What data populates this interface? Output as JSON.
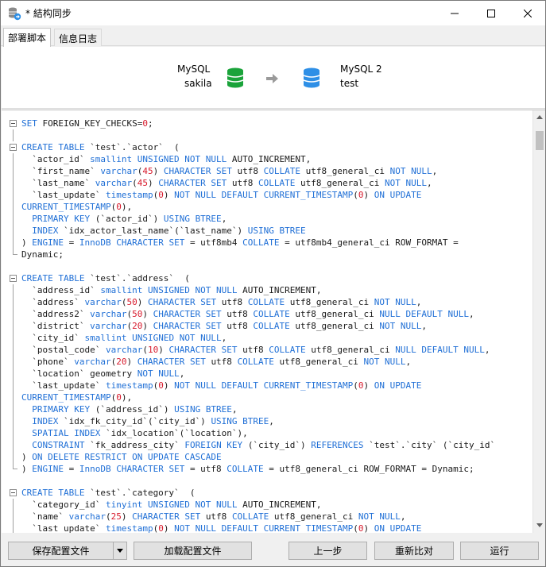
{
  "window": {
    "title": "* 結构同步",
    "icon": "database-sync-icon"
  },
  "tabs": [
    {
      "label": "部署脚本",
      "active": true
    },
    {
      "label": "信息日志",
      "active": false
    }
  ],
  "source": {
    "connection": "MySQL",
    "database": "sakila",
    "color": "#1aa33a"
  },
  "target": {
    "connection": "MySQL 2",
    "database": "test",
    "color": "#2e8fe6"
  },
  "colors": {
    "keyword": "#1f6fd6",
    "number": "#d7192b"
  },
  "code_lines": [
    [
      {
        "t": "SET ",
        "k": 1
      },
      {
        "t": "FOREIGN_KEY_CHECKS="
      },
      {
        "t": "0",
        "n": 1
      },
      {
        "t": ";"
      }
    ],
    [],
    [
      {
        "t": "CREATE TABLE ",
        "k": 1
      },
      {
        "t": "`test`.`actor`  ("
      }
    ],
    [
      {
        "t": "  `actor_id` "
      },
      {
        "t": "smallint UNSIGNED NOT NULL ",
        "k": 1
      },
      {
        "t": "AUTO_INCREMENT,"
      }
    ],
    [
      {
        "t": "  `first_name` "
      },
      {
        "t": "varchar",
        "k": 1
      },
      {
        "t": "("
      },
      {
        "t": "45",
        "n": 1
      },
      {
        "t": ") "
      },
      {
        "t": "CHARACTER SET ",
        "k": 1
      },
      {
        "t": "utf8 "
      },
      {
        "t": "COLLATE ",
        "k": 1
      },
      {
        "t": "utf8_general_ci "
      },
      {
        "t": "NOT NULL",
        "k": 1
      },
      {
        "t": ","
      }
    ],
    [
      {
        "t": "  `last_name` "
      },
      {
        "t": "varchar",
        "k": 1
      },
      {
        "t": "("
      },
      {
        "t": "45",
        "n": 1
      },
      {
        "t": ") "
      },
      {
        "t": "CHARACTER SET ",
        "k": 1
      },
      {
        "t": "utf8 "
      },
      {
        "t": "COLLATE ",
        "k": 1
      },
      {
        "t": "utf8_general_ci "
      },
      {
        "t": "NOT NULL",
        "k": 1
      },
      {
        "t": ","
      }
    ],
    [
      {
        "t": "  `last_update` "
      },
      {
        "t": "timestamp",
        "k": 1
      },
      {
        "t": "("
      },
      {
        "t": "0",
        "n": 1
      },
      {
        "t": ") "
      },
      {
        "t": "NOT NULL DEFAULT CURRENT_TIMESTAMP",
        "k": 1
      },
      {
        "t": "("
      },
      {
        "t": "0",
        "n": 1
      },
      {
        "t": ") "
      },
      {
        "t": "ON UPDATE",
        "k": 1
      }
    ],
    [
      {
        "t": "CURRENT_TIMESTAMP",
        "k": 1
      },
      {
        "t": "("
      },
      {
        "t": "0",
        "n": 1
      },
      {
        "t": "),"
      }
    ],
    [
      {
        "t": "  "
      },
      {
        "t": "PRIMARY KEY ",
        "k": 1
      },
      {
        "t": "(`actor_id`) "
      },
      {
        "t": "USING BTREE",
        "k": 1
      },
      {
        "t": ","
      }
    ],
    [
      {
        "t": "  "
      },
      {
        "t": "INDEX ",
        "k": 1
      },
      {
        "t": "`idx_actor_last_name`(`last_name`) "
      },
      {
        "t": "USING BTREE",
        "k": 1
      }
    ],
    [
      {
        "t": ") "
      },
      {
        "t": "ENGINE ",
        "k": 1
      },
      {
        "t": "= "
      },
      {
        "t": "InnoDB ",
        "k": 1
      },
      {
        "t": "CHARACTER SET ",
        "k": 1
      },
      {
        "t": "= utf8mb4 "
      },
      {
        "t": "COLLATE ",
        "k": 1
      },
      {
        "t": "= utf8mb4_general_ci ROW_FORMAT ="
      }
    ],
    [
      {
        "t": "Dynamic;"
      }
    ],
    [],
    [
      {
        "t": "CREATE TABLE ",
        "k": 1
      },
      {
        "t": "`test`.`address`  ("
      }
    ],
    [
      {
        "t": "  `address_id` "
      },
      {
        "t": "smallint UNSIGNED NOT NULL ",
        "k": 1
      },
      {
        "t": "AUTO_INCREMENT,"
      }
    ],
    [
      {
        "t": "  `address` "
      },
      {
        "t": "varchar",
        "k": 1
      },
      {
        "t": "("
      },
      {
        "t": "50",
        "n": 1
      },
      {
        "t": ") "
      },
      {
        "t": "CHARACTER SET ",
        "k": 1
      },
      {
        "t": "utf8 "
      },
      {
        "t": "COLLATE ",
        "k": 1
      },
      {
        "t": "utf8_general_ci "
      },
      {
        "t": "NOT NULL",
        "k": 1
      },
      {
        "t": ","
      }
    ],
    [
      {
        "t": "  `address2` "
      },
      {
        "t": "varchar",
        "k": 1
      },
      {
        "t": "("
      },
      {
        "t": "50",
        "n": 1
      },
      {
        "t": ") "
      },
      {
        "t": "CHARACTER SET ",
        "k": 1
      },
      {
        "t": "utf8 "
      },
      {
        "t": "COLLATE ",
        "k": 1
      },
      {
        "t": "utf8_general_ci "
      },
      {
        "t": "NULL DEFAULT NULL",
        "k": 1
      },
      {
        "t": ","
      }
    ],
    [
      {
        "t": "  `district` "
      },
      {
        "t": "varchar",
        "k": 1
      },
      {
        "t": "("
      },
      {
        "t": "20",
        "n": 1
      },
      {
        "t": ") "
      },
      {
        "t": "CHARACTER SET ",
        "k": 1
      },
      {
        "t": "utf8 "
      },
      {
        "t": "COLLATE ",
        "k": 1
      },
      {
        "t": "utf8_general_ci "
      },
      {
        "t": "NOT NULL",
        "k": 1
      },
      {
        "t": ","
      }
    ],
    [
      {
        "t": "  `city_id` "
      },
      {
        "t": "smallint UNSIGNED NOT NULL",
        "k": 1
      },
      {
        "t": ","
      }
    ],
    [
      {
        "t": "  `postal_code` "
      },
      {
        "t": "varchar",
        "k": 1
      },
      {
        "t": "("
      },
      {
        "t": "10",
        "n": 1
      },
      {
        "t": ") "
      },
      {
        "t": "CHARACTER SET ",
        "k": 1
      },
      {
        "t": "utf8 "
      },
      {
        "t": "COLLATE ",
        "k": 1
      },
      {
        "t": "utf8_general_ci "
      },
      {
        "t": "NULL DEFAULT NULL",
        "k": 1
      },
      {
        "t": ","
      }
    ],
    [
      {
        "t": "  `phone` "
      },
      {
        "t": "varchar",
        "k": 1
      },
      {
        "t": "("
      },
      {
        "t": "20",
        "n": 1
      },
      {
        "t": ") "
      },
      {
        "t": "CHARACTER SET ",
        "k": 1
      },
      {
        "t": "utf8 "
      },
      {
        "t": "COLLATE ",
        "k": 1
      },
      {
        "t": "utf8_general_ci "
      },
      {
        "t": "NOT NULL",
        "k": 1
      },
      {
        "t": ","
      }
    ],
    [
      {
        "t": "  `location` geometry "
      },
      {
        "t": "NOT NULL",
        "k": 1
      },
      {
        "t": ","
      }
    ],
    [
      {
        "t": "  `last_update` "
      },
      {
        "t": "timestamp",
        "k": 1
      },
      {
        "t": "("
      },
      {
        "t": "0",
        "n": 1
      },
      {
        "t": ") "
      },
      {
        "t": "NOT NULL DEFAULT CURRENT_TIMESTAMP",
        "k": 1
      },
      {
        "t": "("
      },
      {
        "t": "0",
        "n": 1
      },
      {
        "t": ") "
      },
      {
        "t": "ON UPDATE",
        "k": 1
      }
    ],
    [
      {
        "t": "CURRENT_TIMESTAMP",
        "k": 1
      },
      {
        "t": "("
      },
      {
        "t": "0",
        "n": 1
      },
      {
        "t": "),"
      }
    ],
    [
      {
        "t": "  "
      },
      {
        "t": "PRIMARY KEY ",
        "k": 1
      },
      {
        "t": "(`address_id`) "
      },
      {
        "t": "USING BTREE",
        "k": 1
      },
      {
        "t": ","
      }
    ],
    [
      {
        "t": "  "
      },
      {
        "t": "INDEX ",
        "k": 1
      },
      {
        "t": "`idx_fk_city_id`(`city_id`) "
      },
      {
        "t": "USING BTREE",
        "k": 1
      },
      {
        "t": ","
      }
    ],
    [
      {
        "t": "  "
      },
      {
        "t": "SPATIAL INDEX ",
        "k": 1
      },
      {
        "t": "`idx_location`(`location`),"
      }
    ],
    [
      {
        "t": "  "
      },
      {
        "t": "CONSTRAINT ",
        "k": 1
      },
      {
        "t": "`fk_address_city` "
      },
      {
        "t": "FOREIGN KEY ",
        "k": 1
      },
      {
        "t": "(`city_id`) "
      },
      {
        "t": "REFERENCES ",
        "k": 1
      },
      {
        "t": "`test`.`city` (`city_id`"
      }
    ],
    [
      {
        "t": ") "
      },
      {
        "t": "ON DELETE RESTRICT ON UPDATE CASCADE",
        "k": 1
      }
    ],
    [
      {
        "t": ") "
      },
      {
        "t": "ENGINE ",
        "k": 1
      },
      {
        "t": "= "
      },
      {
        "t": "InnoDB ",
        "k": 1
      },
      {
        "t": "CHARACTER SET ",
        "k": 1
      },
      {
        "t": "= utf8 "
      },
      {
        "t": "COLLATE ",
        "k": 1
      },
      {
        "t": "= utf8_general_ci ROW_FORMAT = Dynamic;"
      }
    ],
    [],
    [
      {
        "t": "CREATE TABLE ",
        "k": 1
      },
      {
        "t": "`test`.`category`  ("
      }
    ],
    [
      {
        "t": "  `category_id` "
      },
      {
        "t": "tinyint UNSIGNED NOT NULL ",
        "k": 1
      },
      {
        "t": "AUTO_INCREMENT,"
      }
    ],
    [
      {
        "t": "  `name` "
      },
      {
        "t": "varchar",
        "k": 1
      },
      {
        "t": "("
      },
      {
        "t": "25",
        "n": 1
      },
      {
        "t": ") "
      },
      {
        "t": "CHARACTER SET ",
        "k": 1
      },
      {
        "t": "utf8 "
      },
      {
        "t": "COLLATE ",
        "k": 1
      },
      {
        "t": "utf8_general_ci "
      },
      {
        "t": "NOT NULL",
        "k": 1
      },
      {
        "t": ","
      }
    ],
    [
      {
        "t": "  `last_update` "
      },
      {
        "t": "timestamp",
        "k": 1
      },
      {
        "t": "("
      },
      {
        "t": "0",
        "n": 1
      },
      {
        "t": ") "
      },
      {
        "t": "NOT NULL DEFAULT CURRENT_TIMESTAMP",
        "k": 1
      },
      {
        "t": "("
      },
      {
        "t": "0",
        "n": 1
      },
      {
        "t": ") "
      },
      {
        "t": "ON UPDATE",
        "k": 1
      }
    ]
  ],
  "fold_markers": [
    "block-start",
    "",
    "block-start",
    "",
    "",
    "",
    "",
    "",
    "",
    "",
    "",
    "block-end",
    "",
    "block-start",
    "",
    "",
    "",
    "",
    "",
    "",
    "",
    "",
    "",
    "",
    "",
    "",
    "",
    "",
    "",
    "block-end",
    "",
    "block-start",
    "",
    "",
    ""
  ],
  "buttons": {
    "save_config": "保存配置文件",
    "load_config": "加载配置文件",
    "previous": "上一步",
    "recompare": "重新比对",
    "run": "运行"
  }
}
